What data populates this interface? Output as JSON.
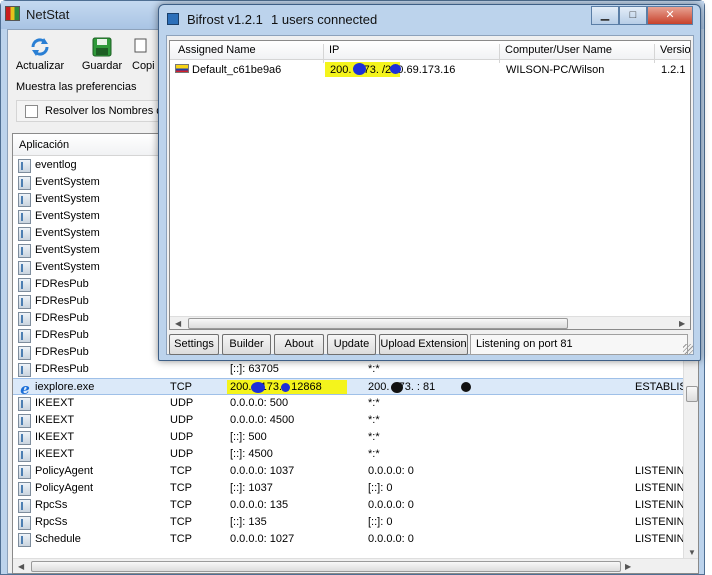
{
  "netstat": {
    "title": "NetStat",
    "toolbar": [
      {
        "label": "Actualizar",
        "icon": "refresh-icon"
      },
      {
        "label": "Guardar",
        "icon": "save-disk-icon"
      },
      {
        "label": "Copi",
        "icon": "copy-icon"
      }
    ],
    "prefs_label": "Muestra las preferencias",
    "resolve_label": "Resolver los Nombres de",
    "columns": {
      "app": "Aplicación"
    },
    "rows": [
      {
        "app": "eventlog",
        "proto": "",
        "local": "",
        "remote": "",
        "state": ""
      },
      {
        "app": "EventSystem",
        "proto": "",
        "local": "",
        "remote": "",
        "state": ""
      },
      {
        "app": "EventSystem",
        "proto": "",
        "local": "",
        "remote": "",
        "state": ""
      },
      {
        "app": "EventSystem",
        "proto": "",
        "local": "",
        "remote": "",
        "state": ""
      },
      {
        "app": "EventSystem",
        "proto": "",
        "local": "",
        "remote": "",
        "state": ""
      },
      {
        "app": "EventSystem",
        "proto": "",
        "local": "",
        "remote": "",
        "state": ""
      },
      {
        "app": "EventSystem",
        "proto": "",
        "local": "",
        "remote": "",
        "state": ""
      },
      {
        "app": "FDResPub",
        "proto": "",
        "local": "",
        "remote": "",
        "state": ""
      },
      {
        "app": "FDResPub",
        "proto": "",
        "local": "",
        "remote": "",
        "state": ""
      },
      {
        "app": "FDResPub",
        "proto": "",
        "local": "",
        "remote": "",
        "state": ""
      },
      {
        "app": "FDResPub",
        "proto": "",
        "local": "",
        "remote": "",
        "state": ""
      },
      {
        "app": "FDResPub",
        "proto": "",
        "local": "",
        "remote": "",
        "state": ""
      },
      {
        "app": "FDResPub",
        "proto": "",
        "local": "[::]: 63705",
        "remote": "*:*",
        "state": ""
      },
      {
        "app": "iexplore.exe",
        "proto": "TCP",
        "local": "200.  . 173.  : 12868",
        "remote": "200.   173.   : 81",
        "state": "ESTABLIS"
      },
      {
        "app": "IKEEXT",
        "proto": "UDP",
        "local": "0.0.0.0: 500",
        "remote": "*:*",
        "state": ""
      },
      {
        "app": "IKEEXT",
        "proto": "UDP",
        "local": "0.0.0.0: 4500",
        "remote": "*:*",
        "state": ""
      },
      {
        "app": "IKEEXT",
        "proto": "UDP",
        "local": "[::]: 500",
        "remote": "*:*",
        "state": ""
      },
      {
        "app": "IKEEXT",
        "proto": "UDP",
        "local": "[::]: 4500",
        "remote": "*:*",
        "state": ""
      },
      {
        "app": "PolicyAgent",
        "proto": "TCP",
        "local": "0.0.0.0: 1037",
        "remote": "0.0.0.0: 0",
        "state": "LISTENIN"
      },
      {
        "app": "PolicyAgent",
        "proto": "TCP",
        "local": "[::]: 1037",
        "remote": "[::]: 0",
        "state": "LISTENIN"
      },
      {
        "app": "RpcSs",
        "proto": "TCP",
        "local": "0.0.0.0: 135",
        "remote": "0.0.0.0: 0",
        "state": "LISTENIN"
      },
      {
        "app": "RpcSs",
        "proto": "TCP",
        "local": "[::]: 135",
        "remote": "[::]: 0",
        "state": "LISTENIN"
      },
      {
        "app": "Schedule",
        "proto": "TCP",
        "local": "0.0.0.0: 1027",
        "remote": "0.0.0.0: 0",
        "state": "LISTENIN"
      }
    ]
  },
  "bifrost": {
    "title": "Bifrost v1.2.1",
    "users": "1 users connected",
    "columns": {
      "name": "Assigned Name",
      "ip": "IP",
      "computer": "Computer/User Name",
      "version": "Versio"
    },
    "row": {
      "name": "Default_c61be9a6",
      "ip": "200.   .173.  /200.69.173.16",
      "computer": "WILSON-PC/Wilson",
      "version": "1.2.1"
    },
    "buttons": {
      "settings": "Settings",
      "builder": "Builder",
      "about": "About",
      "update": "Update",
      "upload": "Upload Extension"
    },
    "status": "Listening on port 81"
  }
}
